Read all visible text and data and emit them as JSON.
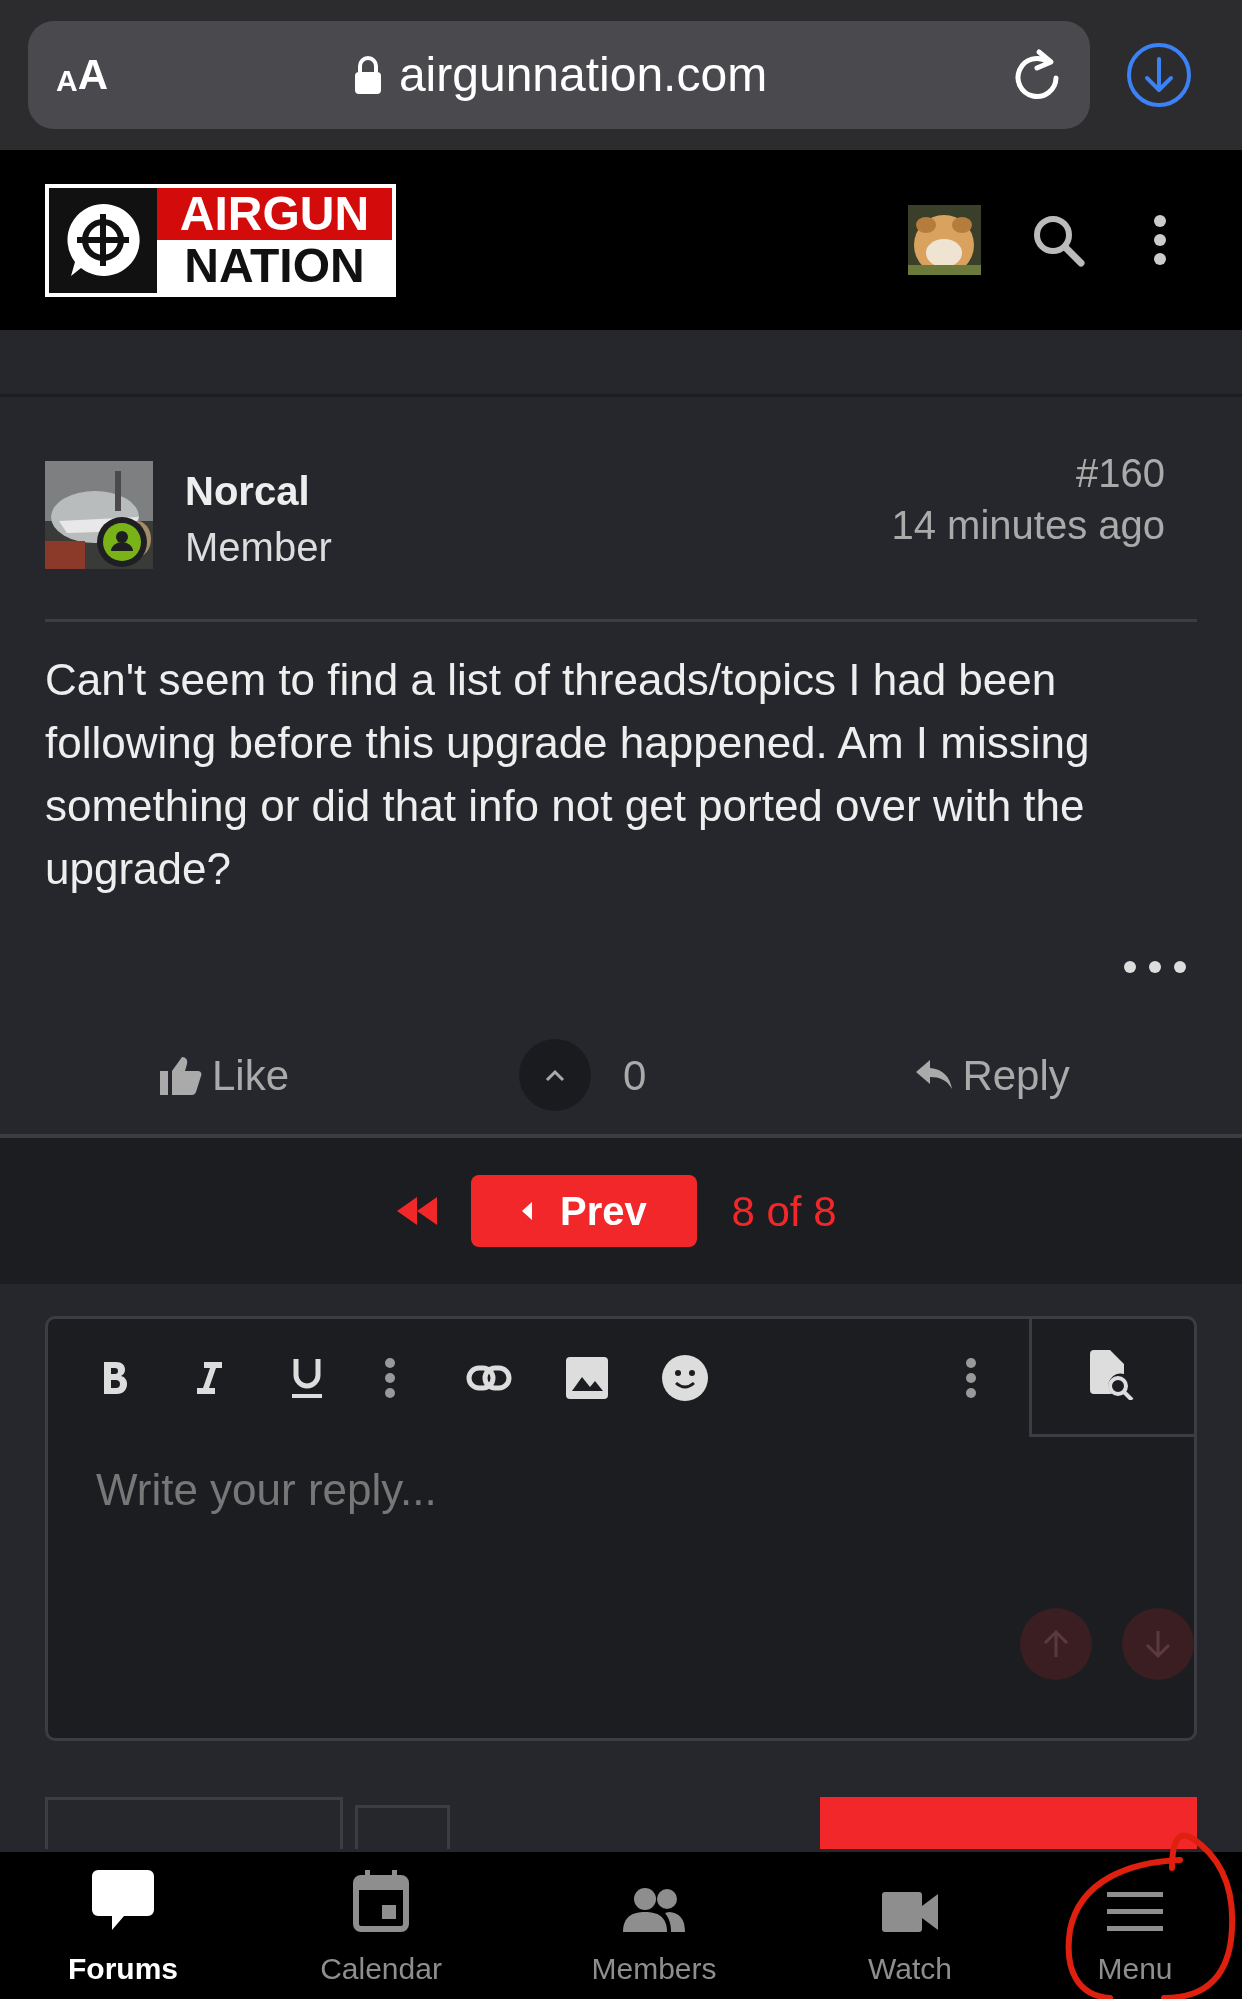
{
  "browser": {
    "text_size_button": "AA",
    "url": "airgunnation.com"
  },
  "site_header": {
    "logo_top": "AIRGUN",
    "logo_bottom": "NATION"
  },
  "post": {
    "author": "Norcal",
    "role": "Member",
    "online": true,
    "number": "#160",
    "time": "14 minutes ago",
    "body": "Can't seem to find a list of threads/topics I had been following before this upgrade happened. Am I missing something or did that info not get ported over with the upgrade?",
    "actions": {
      "like": "Like",
      "score": "0",
      "reply": "Reply"
    }
  },
  "pagination": {
    "prev": "Prev",
    "page": "8 of 8"
  },
  "editor": {
    "placeholder": "Write your reply..."
  },
  "bottom_nav": [
    {
      "label": "Forums",
      "kind": "chat",
      "selected": true,
      "circled": false
    },
    {
      "label": "Calendar",
      "kind": "calendar",
      "selected": false,
      "circled": false
    },
    {
      "label": "Members",
      "kind": "people",
      "selected": false,
      "circled": false
    },
    {
      "label": "Watch",
      "kind": "video",
      "selected": false,
      "circled": false
    },
    {
      "label": "Menu",
      "kind": "menu",
      "selected": false,
      "circled": true
    }
  ]
}
